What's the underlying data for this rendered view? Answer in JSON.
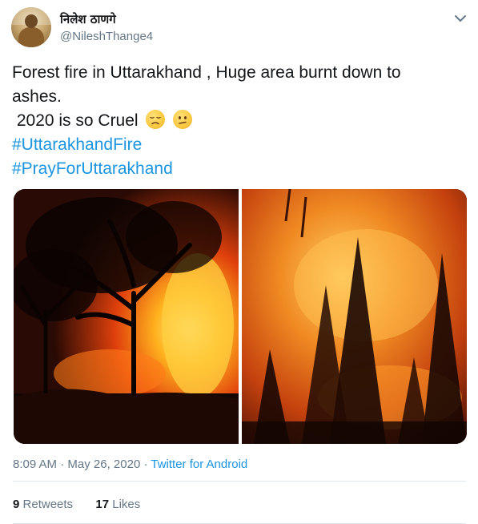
{
  "author": {
    "name": "निलेश ठाणगे",
    "handle": "@NileshThange4"
  },
  "tweet": {
    "lines": [
      "Forest fire in Uttarakhand , Huge area burnt down to",
      "ashes.",
      " 2020 is so Cruel"
    ],
    "emojis": [
      "disappointed-face-icon",
      "confused-face-icon"
    ],
    "hashtags": [
      "#UttarakhandFire",
      "#PrayForUttarakhand"
    ]
  },
  "meta": {
    "time": "8:09 AM",
    "separator": " · ",
    "date": "May 26, 2020",
    "source": "Twitter for Android"
  },
  "stats": {
    "retweets_count": "9",
    "retweets_label": "Retweets",
    "likes_count": "17",
    "likes_label": "Likes"
  },
  "colors": {
    "link": "#1b95e0",
    "secondary_text": "#657786",
    "divider": "#e1e8ed"
  }
}
